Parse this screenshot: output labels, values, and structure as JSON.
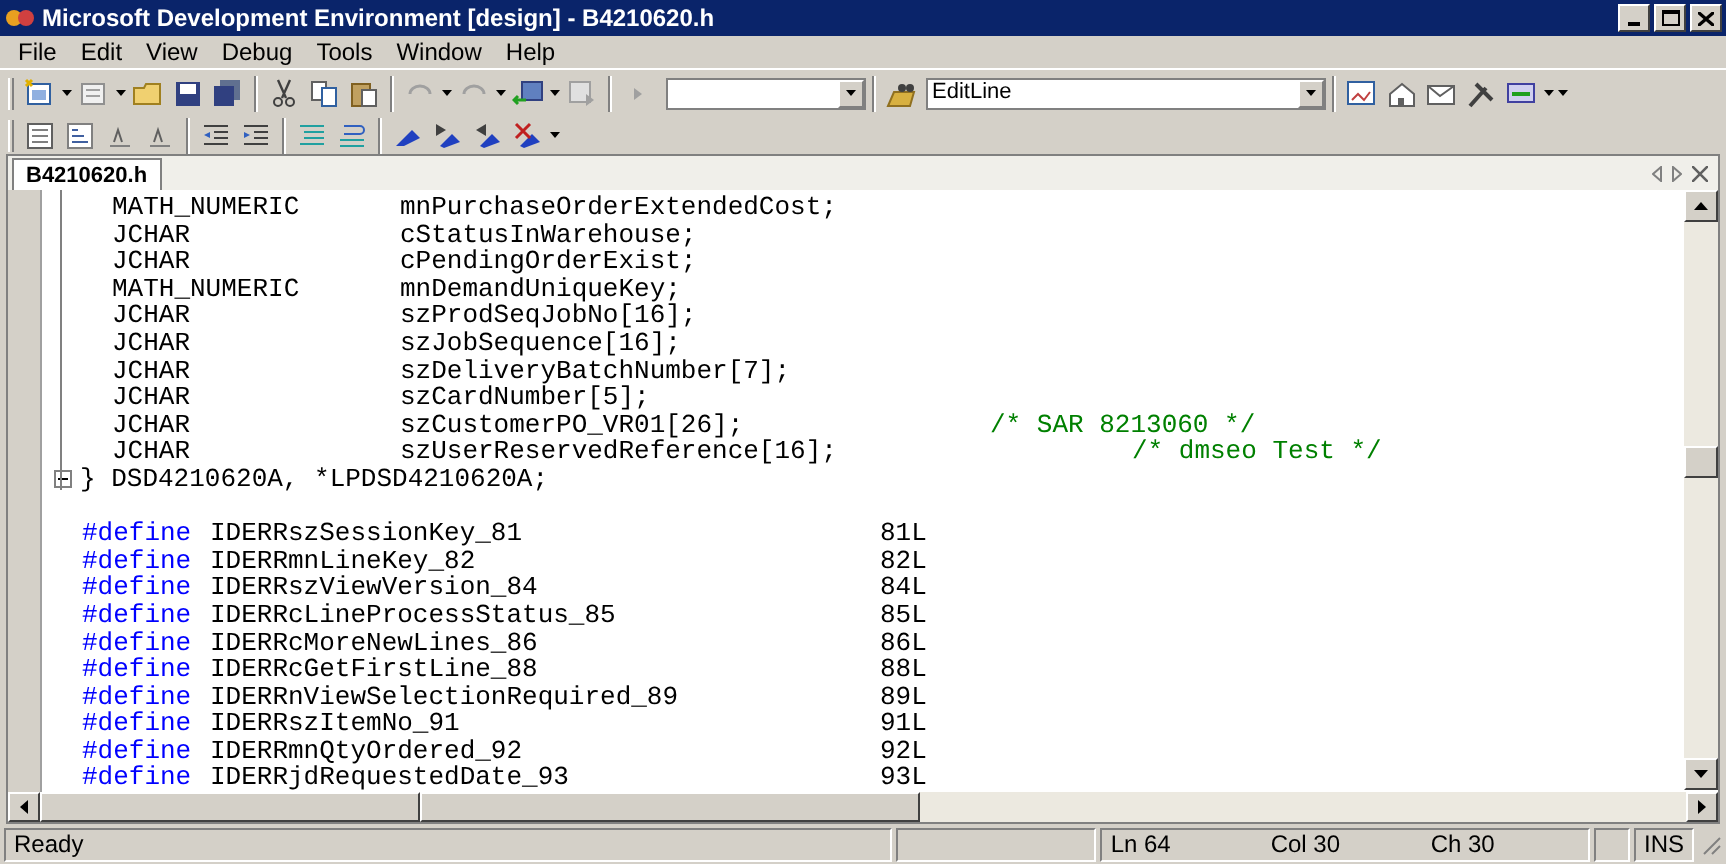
{
  "window": {
    "title": "Microsoft Development Environment [design] - B4210620.h"
  },
  "menu": [
    "File",
    "Edit",
    "View",
    "Debug",
    "Tools",
    "Window",
    "Help"
  ],
  "toolbar": {
    "find_combo": {
      "value": "EditLine"
    }
  },
  "tabs": [
    {
      "label": "B4210620.h",
      "selected": true
    }
  ],
  "editor": {
    "lines": [
      {
        "kind": "decl",
        "type": "MATH_NUMERIC",
        "name": "mnPurchaseOrderExtendedCost;"
      },
      {
        "kind": "decl",
        "type": "JCHAR",
        "name": "cStatusInWarehouse;"
      },
      {
        "kind": "decl",
        "type": "JCHAR",
        "name": "cPendingOrderExist;"
      },
      {
        "kind": "decl",
        "type": "MATH_NUMERIC",
        "name": "mnDemandUniqueKey;"
      },
      {
        "kind": "decl",
        "type": "JCHAR",
        "name": "szProdSeqJobNo[16];"
      },
      {
        "kind": "decl",
        "type": "JCHAR",
        "name": "szJobSequence[16];"
      },
      {
        "kind": "decl",
        "type": "JCHAR",
        "name": "szDeliveryBatchNumber[7];"
      },
      {
        "kind": "decl",
        "type": "JCHAR",
        "name": "szCardNumber[5];"
      },
      {
        "kind": "decl",
        "type": "JCHAR",
        "name": "szCustomerPO_VR01[26];",
        "comment": "/* SAR 8213060 */"
      },
      {
        "kind": "decl",
        "type": "JCHAR",
        "name": "szUserReservedReference[16];",
        "comment": "/* dmseo Test */",
        "comment_far": true
      },
      {
        "kind": "close",
        "text": "} DSD4210620A, *LPDSD4210620A;",
        "collapsible": true
      },
      {
        "kind": "blank"
      },
      {
        "kind": "define",
        "keyword": "#define",
        "name": "IDERRszSessionKey_81",
        "value": "81L"
      },
      {
        "kind": "define",
        "keyword": "#define",
        "name": "IDERRmnLineKey_82",
        "value": "82L"
      },
      {
        "kind": "define",
        "keyword": "#define",
        "name": "IDERRszViewVersion_84",
        "value": "84L"
      },
      {
        "kind": "define",
        "keyword": "#define",
        "name": "IDERRcLineProcessStatus_85",
        "value": "85L"
      },
      {
        "kind": "define",
        "keyword": "#define",
        "name": "IDERRcMoreNewLines_86",
        "value": "86L"
      },
      {
        "kind": "define",
        "keyword": "#define",
        "name": "IDERRcGetFirstLine_88",
        "value": "88L"
      },
      {
        "kind": "define",
        "keyword": "#define",
        "name": "IDERRnViewSelectionRequired_89",
        "value": "89L"
      },
      {
        "kind": "define",
        "keyword": "#define",
        "name": "IDERRszItemNo_91",
        "value": "91L"
      },
      {
        "kind": "define",
        "keyword": "#define",
        "name": "IDERRmnQtyOrdered_92",
        "value": "92L"
      },
      {
        "kind": "define",
        "keyword": "#define",
        "name": "IDERRjdRequestedDate_93",
        "value": "93L"
      }
    ]
  },
  "status_bar": {
    "message": "Ready",
    "line": "Ln 64",
    "column": "Col 30",
    "char": "Ch 30",
    "mode": "INS"
  }
}
